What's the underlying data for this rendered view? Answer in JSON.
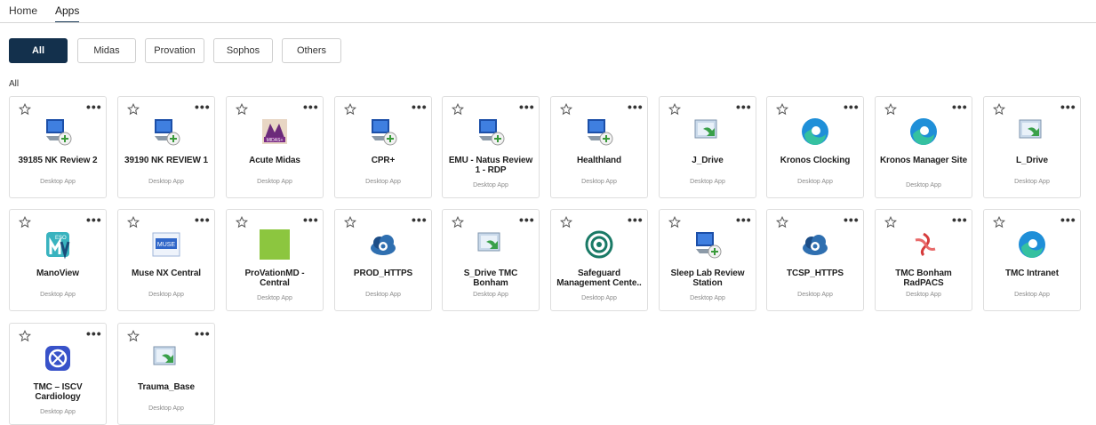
{
  "nav": {
    "home": "Home",
    "apps": "Apps"
  },
  "filters": [
    "All",
    "Midas",
    "Provation",
    "Sophos",
    "Others"
  ],
  "section_label": "All",
  "desktop_app_label": "Desktop App",
  "more_glyph": "•••",
  "apps": [
    {
      "name": "39185 NK Review 2",
      "icon": "rdp-computer-icon"
    },
    {
      "name": "39190 NK REVIEW 1",
      "icon": "rdp-computer-icon"
    },
    {
      "name": "Acute Midas",
      "icon": "midas-logo-icon"
    },
    {
      "name": "CPR+",
      "icon": "rdp-computer-icon"
    },
    {
      "name": "EMU - Natus Review 1 - RDP",
      "icon": "rdp-computer-icon"
    },
    {
      "name": "Healthland",
      "icon": "rdp-computer-icon"
    },
    {
      "name": "J_Drive",
      "icon": "folder-shortcut-icon"
    },
    {
      "name": "Kronos Clocking",
      "icon": "edge-browser-icon"
    },
    {
      "name": "Kronos Manager Site",
      "icon": "edge-browser-icon"
    },
    {
      "name": "L_Drive",
      "icon": "folder-shortcut-icon"
    },
    {
      "name": "ManoView",
      "icon": "manoview-logo-icon"
    },
    {
      "name": "Muse NX Central",
      "icon": "muse-logo-icon"
    },
    {
      "name": "ProVationMD - Central",
      "icon": "provation-green-square-icon"
    },
    {
      "name": "PROD_HTTPS",
      "icon": "cloud-gear-icon"
    },
    {
      "name": "S_Drive TMC Bonham",
      "icon": "folder-shortcut-icon"
    },
    {
      "name": "Safeguard Management Cente..",
      "icon": "safeguard-gear-icon"
    },
    {
      "name": "Sleep Lab Review Station",
      "icon": "rdp-computer-icon"
    },
    {
      "name": "TCSP_HTTPS",
      "icon": "cloud-gear-icon"
    },
    {
      "name": "TMC Bonham RadPACS",
      "icon": "radpacs-swirl-icon"
    },
    {
      "name": "TMC Intranet",
      "icon": "edge-browser-icon"
    },
    {
      "name": "TMC – ISCV Cardiology",
      "icon": "iscv-logo-icon"
    },
    {
      "name": "Trauma_Base",
      "icon": "folder-shortcut-icon"
    }
  ],
  "colors": {
    "accent": "#13304c",
    "border": "#dedede"
  }
}
